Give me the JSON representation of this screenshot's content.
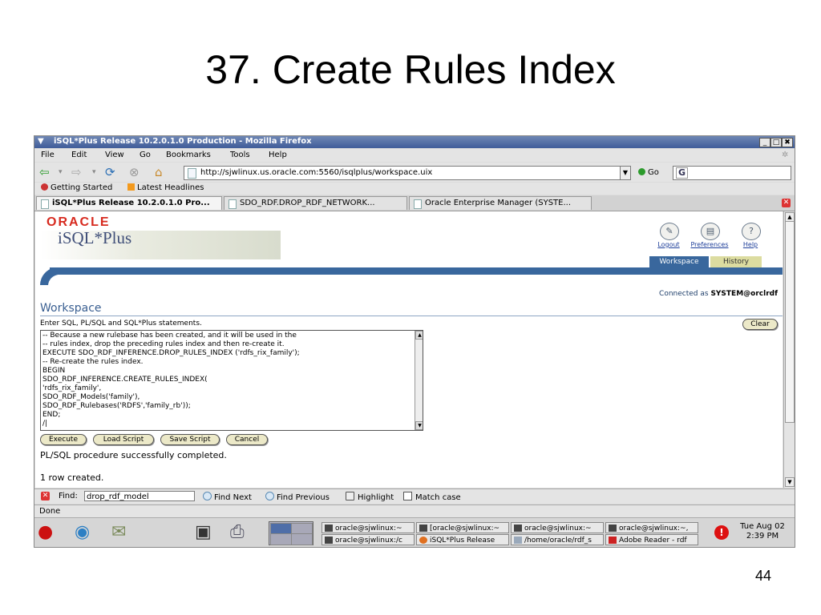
{
  "slide": {
    "title": "37. Create Rules Index",
    "page_number": "44"
  },
  "window": {
    "title": "iSQL*Plus Release 10.2.0.1.0 Production - Mozilla Firefox",
    "minimize": "_",
    "maximize": "□",
    "close": "✖"
  },
  "menu": [
    "File",
    "Edit",
    "View",
    "Go",
    "Bookmarks",
    "Tools",
    "Help"
  ],
  "nav": {
    "url": "http://sjwlinux.us.oracle.com:5560/isqlplus/workspace.uix",
    "go_label": "Go",
    "search_engine": "G"
  },
  "bookmarks": [
    "Getting Started",
    "Latest Headlines"
  ],
  "tabs": [
    "iSQL*Plus Release 10.2.0.1.0 Pro...",
    "SDO_RDF.DROP_RDF_NETWORK...",
    "Oracle Enterprise Manager (SYSTE..."
  ],
  "page": {
    "brand": "ORACLE",
    "product": "iSQL*Plus",
    "header_links": [
      "Logout",
      "Preferences",
      "Help"
    ],
    "nav_tabs": [
      "Workspace",
      "History"
    ],
    "connected_prefix": "Connected as",
    "connected_user": "SYSTEM@orclrdf",
    "section_title": "Workspace",
    "instructions": "Enter SQL, PL/SQL and SQL*Plus statements.",
    "clear_label": "Clear",
    "editor_lines": [
      "-- Because a new rulebase has been created, and it will be used in the",
      "-- rules index, drop the preceding rules index and then re-create it.",
      "EXECUTE SDO_RDF_INFERENCE.DROP_RULES_INDEX ('rdfs_rix_family');",
      "-- Re-create the rules index.",
      "BEGIN",
      "SDO_RDF_INFERENCE.CREATE_RULES_INDEX(",
      "'rdfs_rix_family',",
      "SDO_RDF_Models('family'),",
      "SDO_RDF_Rulebases('RDFS','family_rb'));",
      "END;",
      "/|"
    ],
    "buttons": [
      "Execute",
      "Load Script",
      "Save Script",
      "Cancel"
    ],
    "results": [
      "PL/SQL procedure successfully completed.",
      "1 row created."
    ]
  },
  "find": {
    "label": "Find:",
    "value": "drop_rdf_model",
    "next": "Find Next",
    "previous": "Find Previous",
    "highlight": "Highlight",
    "match_case": "Match case"
  },
  "status": "Done",
  "taskbar": {
    "tasks_row1": [
      "oracle@sjwlinux:~",
      "[oracle@sjwlinux:~",
      "oracle@sjwlinux:~",
      "oracle@sjwlinux:~,"
    ],
    "tasks_row2": [
      "oracle@sjwlinux:/c",
      "iSQL*Plus Release",
      "/home/oracle/rdf_s",
      "Adobe Reader - rdf"
    ],
    "clock_day": "Tue Aug 02",
    "clock_time": "2:39 PM"
  },
  "colors": {
    "oracle_red": "#d72a1f",
    "uix_blue": "#39679d",
    "link_blue": "#1f3f9a"
  }
}
